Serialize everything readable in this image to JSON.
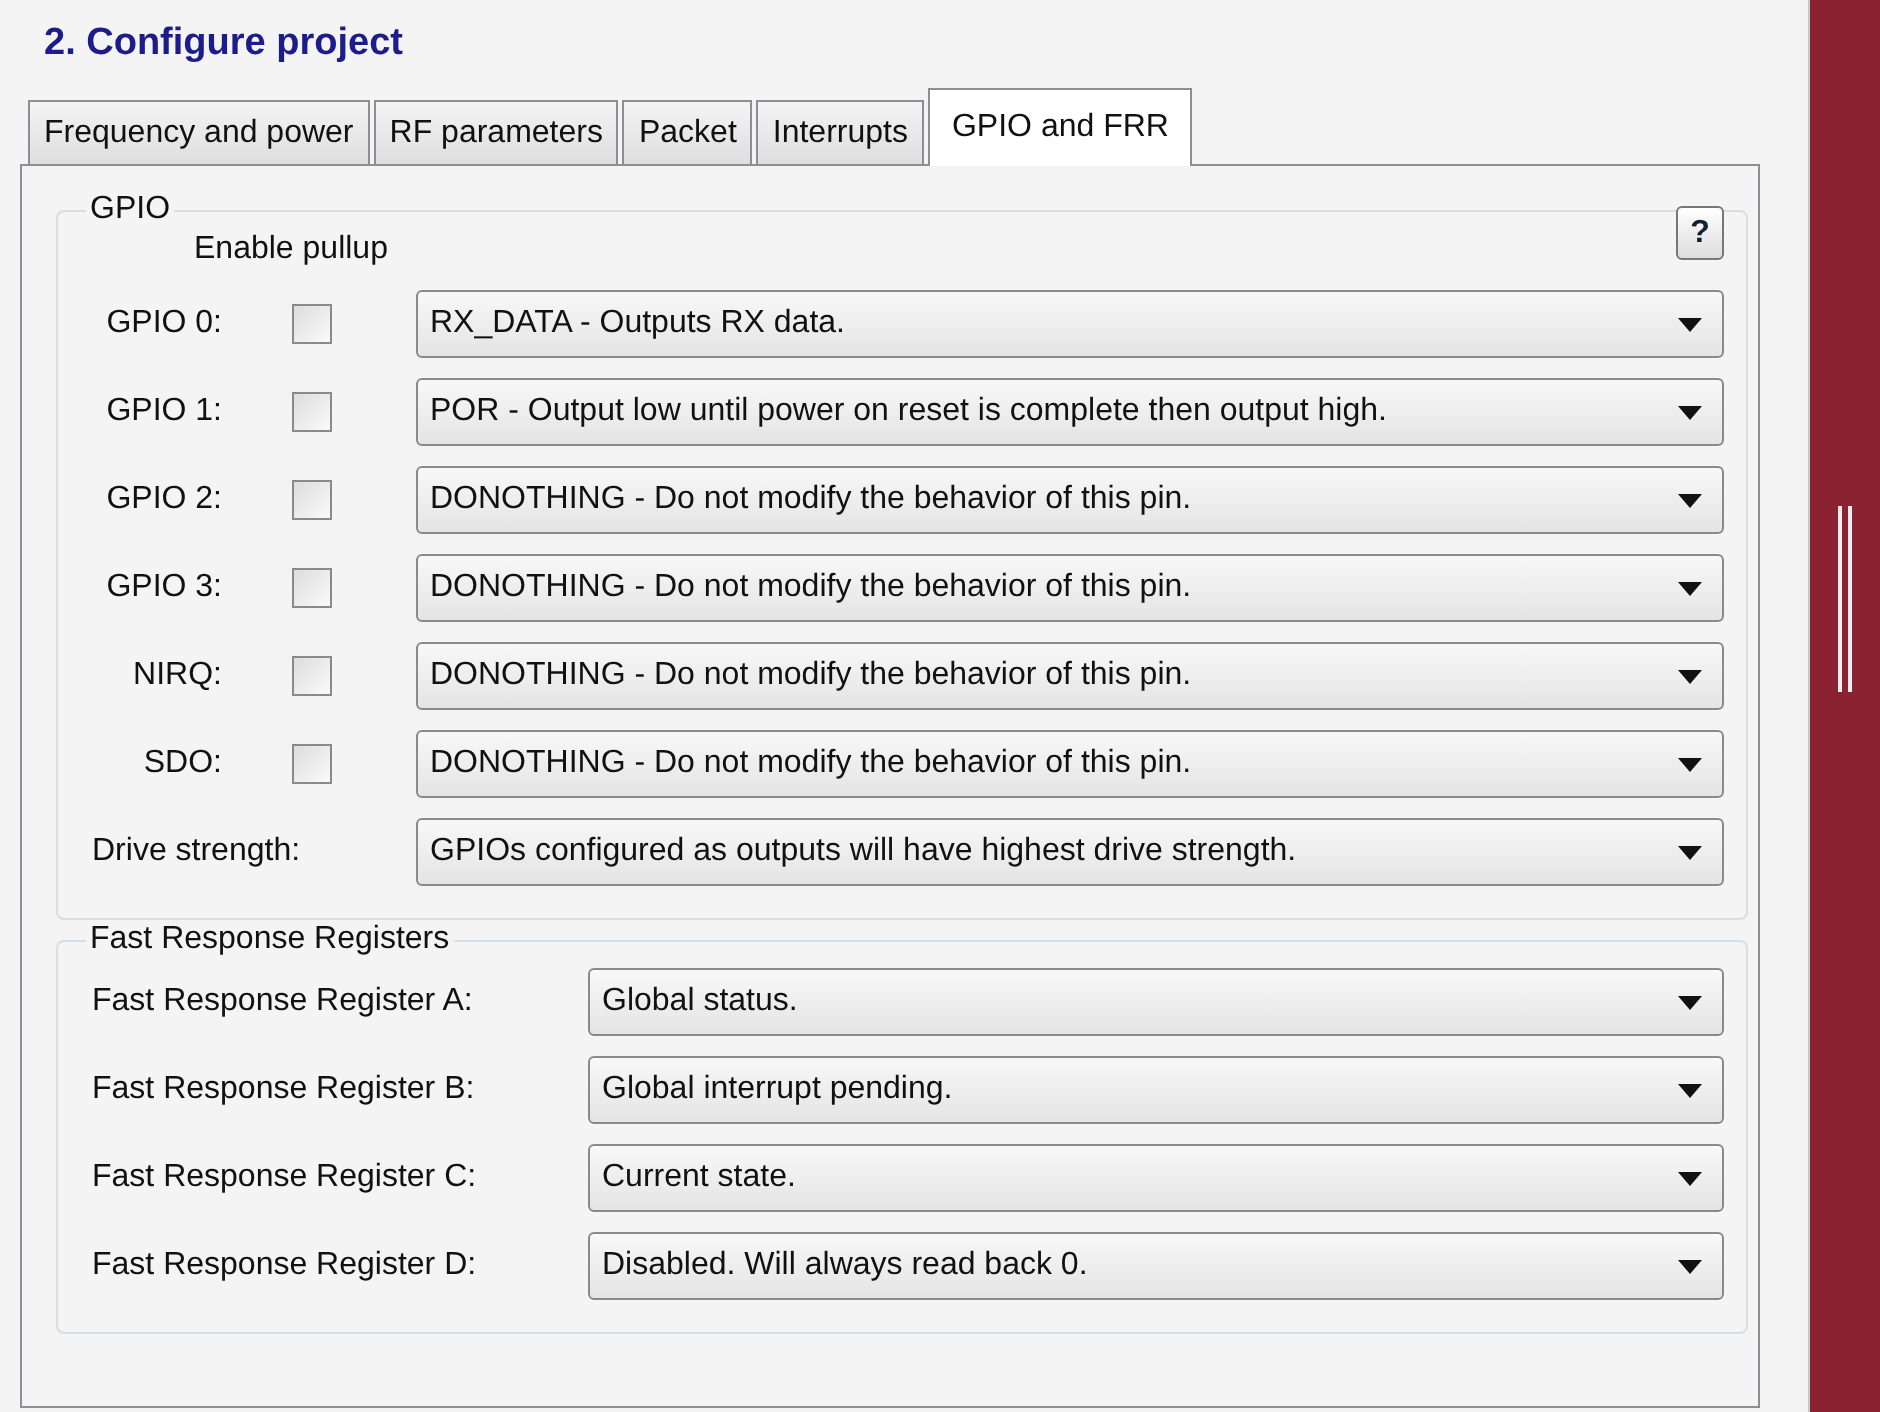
{
  "heading": "2. Configure project",
  "tabs": [
    {
      "label": "Frequency and power",
      "selected": false
    },
    {
      "label": "RF parameters",
      "selected": false
    },
    {
      "label": "Packet",
      "selected": false
    },
    {
      "label": "Interrupts",
      "selected": false
    },
    {
      "label": "GPIO and FRR",
      "selected": true
    }
  ],
  "gpio_group": {
    "title": "GPIO",
    "pullup_header": "Enable pullup",
    "help_button": "?",
    "rows": [
      {
        "kind": "pin",
        "label": "GPIO 0:",
        "pullup": false,
        "value": "RX_DATA - Outputs RX data."
      },
      {
        "kind": "pin",
        "label": "GPIO 1:",
        "pullup": false,
        "value": "POR - Output low until power on reset is complete then output high."
      },
      {
        "kind": "pin",
        "label": "GPIO 2:",
        "pullup": false,
        "value": "DONOTHING - Do not modify the behavior of this pin."
      },
      {
        "kind": "pin",
        "label": "GPIO 3:",
        "pullup": false,
        "value": "DONOTHING - Do not modify the behavior of this pin."
      },
      {
        "kind": "pin",
        "label": "NIRQ:",
        "pullup": false,
        "value": "DONOTHING - Do not modify the behavior of this pin."
      },
      {
        "kind": "pin",
        "label": "SDO:",
        "pullup": false,
        "value": "DONOTHING - Do not modify the behavior of this pin."
      },
      {
        "kind": "setting",
        "label": "Drive strength:",
        "value": "GPIOs configured as outputs will have highest drive strength."
      }
    ]
  },
  "frr_group": {
    "title": "Fast Response Registers",
    "rows": [
      {
        "label": "Fast Response Register A:",
        "value": "Global status."
      },
      {
        "label": "Fast Response Register B:",
        "value": "Global interrupt pending."
      },
      {
        "label": "Fast Response Register C:",
        "value": "Current state."
      },
      {
        "label": "Fast Response Register D:",
        "value": "Disabled. Will always read back 0."
      }
    ]
  }
}
